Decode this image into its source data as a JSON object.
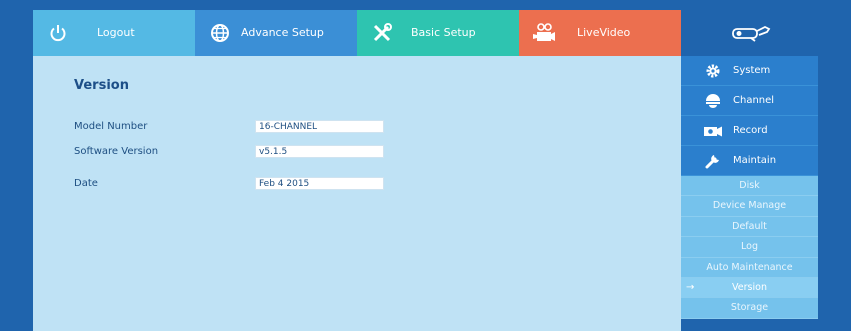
{
  "topnav": {
    "logout": "Logout",
    "advance_setup": "Advance Setup",
    "basic_setup": "Basic Setup",
    "live_video": "LiveVideo"
  },
  "page": {
    "title": "Version",
    "fields": [
      {
        "label": "Model Number",
        "value": "16-CHANNEL"
      },
      {
        "label": "Software Version",
        "value": "v5.1.5"
      },
      {
        "label": "Date",
        "value": "Feb  4 2015"
      }
    ]
  },
  "sidebar": {
    "major": [
      {
        "label": "System",
        "icon": "gear-icon"
      },
      {
        "label": "Channel",
        "icon": "dome-camera-icon"
      },
      {
        "label": "Record",
        "icon": "record-camera-icon"
      },
      {
        "label": "Maintain",
        "icon": "wrench-icon"
      }
    ],
    "sub": [
      {
        "label": "Disk"
      },
      {
        "label": "Device Manage"
      },
      {
        "label": "Default"
      },
      {
        "label": "Log"
      },
      {
        "label": "Auto Maintenance"
      },
      {
        "label": "Version",
        "active": true
      },
      {
        "label": "Storage"
      }
    ]
  },
  "colors": {
    "background": "#1f64ad",
    "logout_tab": "#54b9e4",
    "advance_tab": "#3b8fd6",
    "basic_tab": "#2ec4b0",
    "live_tab": "#ec6f4f",
    "content_bg": "#bfe2f5",
    "sidebar_major": "#2b7fcd",
    "sidebar_sub": "#75c2ec"
  }
}
